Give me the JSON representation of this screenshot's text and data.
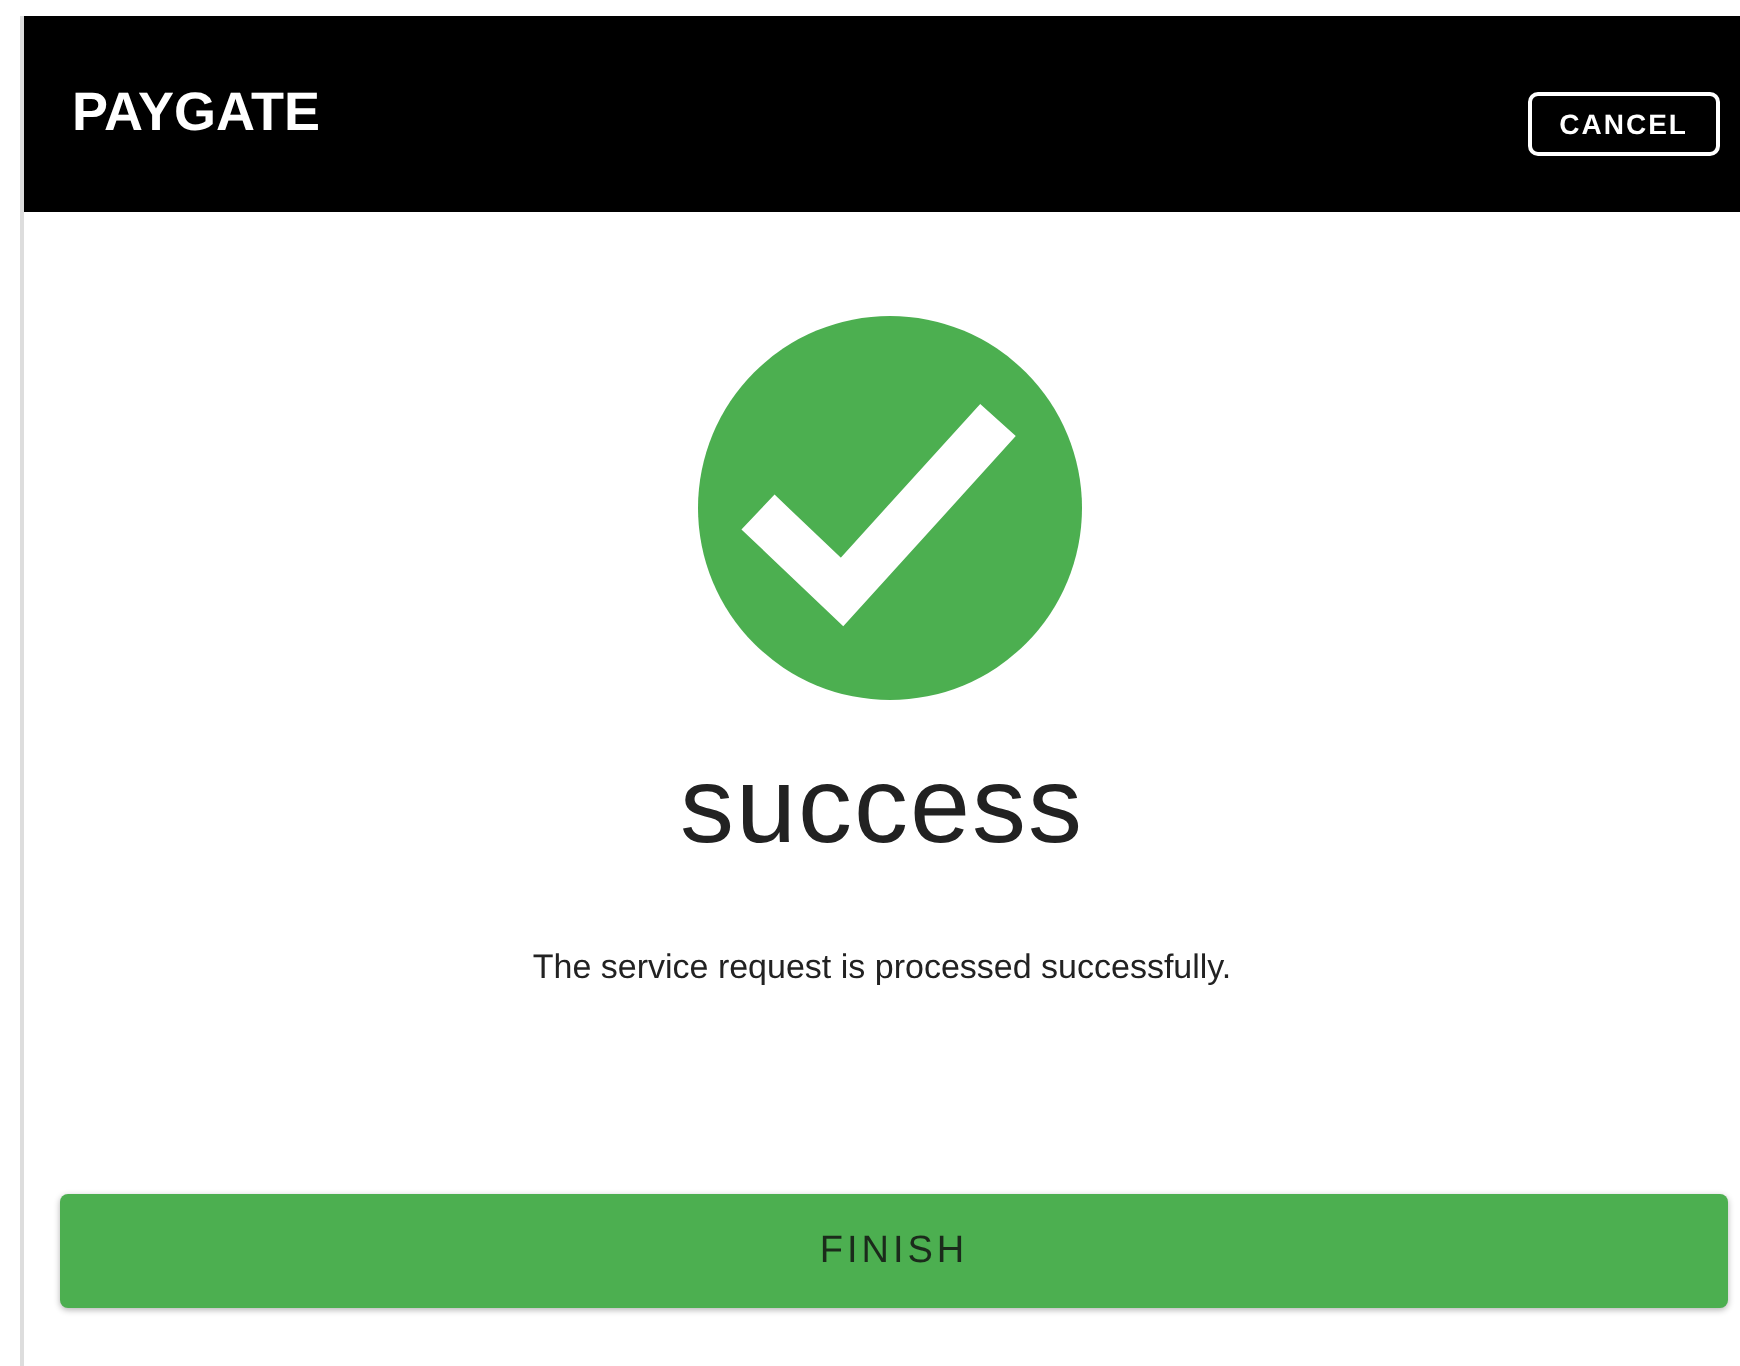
{
  "header": {
    "title": "PAYGATE",
    "cancel_button": "CANCEL"
  },
  "result": {
    "heading": "success",
    "message": "The service request is processed successfully."
  },
  "finish_button": "FINISH"
}
